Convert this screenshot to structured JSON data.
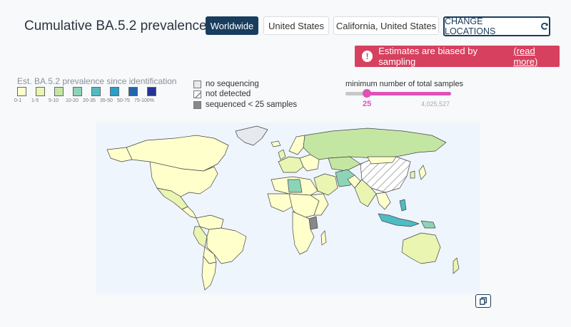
{
  "title": "Cumulative BA.5.2 prevalence",
  "locations": [
    {
      "label": "Worldwide",
      "active": true
    },
    {
      "label": "United States",
      "active": false
    },
    {
      "label": "California, United States",
      "active": false
    }
  ],
  "change_locations_label": "CHANGE LOCATIONS",
  "alert": {
    "text": "Estimates are biased by sampling",
    "link": "(read more)"
  },
  "legend": {
    "title": "Est. BA.5.2 prevalence since identification",
    "bins": [
      {
        "label": "0-1",
        "color": "#ffffcc"
      },
      {
        "label": "1-5",
        "color": "#e9f5b0"
      },
      {
        "label": "5-10",
        "color": "#c4e6a3"
      },
      {
        "label": "10-20",
        "color": "#8dd3b8"
      },
      {
        "label": "20-35",
        "color": "#4fbcc4"
      },
      {
        "label": "35-50",
        "color": "#2c9fc9"
      },
      {
        "label": "50-75",
        "color": "#2464ad"
      },
      {
        "label": "75-100%",
        "color": "#253494"
      }
    ],
    "no_sequencing": "no sequencing",
    "not_detected": "not detected",
    "sequenced_low": "sequenced < 25 samples"
  },
  "slider": {
    "label": "minimum number of total samples",
    "min_value": "25",
    "max_value": "4,025,527",
    "position": 0.0
  },
  "map_colors": {
    "ocean": "#eef5fd",
    "border": "#444444",
    "no_seq": "#e6e9ee",
    "low": "#888888"
  }
}
